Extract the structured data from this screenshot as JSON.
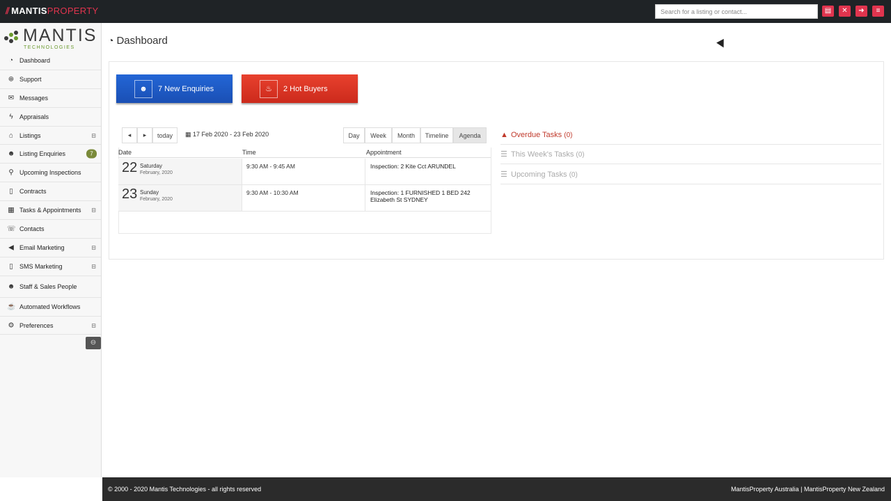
{
  "topbar": {
    "brand_mark": "⫽",
    "brand_part1": "MANTIS",
    "brand_part2": "PROPERTY",
    "search_placeholder": "Search for a listing or contact...",
    "buttons": [
      {
        "icon": "listing-icon",
        "glyph": "▤"
      },
      {
        "icon": "expand-icon",
        "glyph": "✕"
      },
      {
        "icon": "logout-icon",
        "glyph": "➜"
      },
      {
        "icon": "menu-icon",
        "glyph": "≡"
      }
    ]
  },
  "sidebar": {
    "logo_word": "MANTIS",
    "logo_sub": "TECHNOLOGIES",
    "items": [
      {
        "label": "Dashboard",
        "icon": "dashboard-icon",
        "glyph": "◔"
      },
      {
        "label": "Support",
        "icon": "lifebuoy-icon",
        "glyph": "⊕"
      },
      {
        "label": "Messages",
        "icon": "envelope-icon",
        "glyph": "✉"
      },
      {
        "label": "Appraisals",
        "icon": "bolt-icon",
        "glyph": "ϟ"
      },
      {
        "label": "Listings",
        "icon": "home-icon",
        "glyph": "⌂",
        "expand": "⊟"
      },
      {
        "label": "Listing Enquiries",
        "icon": "users-icon",
        "glyph": "☻",
        "badge": "7"
      },
      {
        "label": "Upcoming Inspections",
        "icon": "search-icon",
        "glyph": "⚲"
      },
      {
        "label": "Contracts",
        "icon": "file-icon",
        "glyph": "▯"
      },
      {
        "label": "Tasks & Appointments",
        "icon": "calendar-icon",
        "glyph": "▦",
        "expand": "⊟"
      },
      {
        "label": "Contacts",
        "icon": "phone-icon",
        "glyph": "☏"
      },
      {
        "label": "Email Marketing",
        "icon": "bullhorn-icon",
        "glyph": "◀",
        "expand": "⊟"
      },
      {
        "label": "SMS Marketing",
        "icon": "mobile-icon",
        "glyph": "▯",
        "expand": "⊟"
      },
      {
        "label": "Staff & Sales People",
        "icon": "group-icon",
        "glyph": "☻"
      },
      {
        "label": "Automated Workflows",
        "icon": "coffee-icon",
        "glyph": "☕"
      },
      {
        "label": "Preferences",
        "icon": "gear-icon",
        "glyph": "⚙",
        "expand": "⊟"
      }
    ],
    "collapse_glyph": "⊖"
  },
  "main": {
    "page_title": "Dashboard",
    "title_glyph": "◔",
    "btn_enquiries": {
      "label": "7 New Enquiries",
      "glyph": "☻"
    },
    "btn_hot": {
      "label": "2 Hot Buyers",
      "glyph": "♨"
    },
    "calendar": {
      "prev": "◂",
      "next": "▸",
      "today": "today",
      "range_glyph": "▦",
      "range": "17 Feb 2020 - 23 Feb 2020",
      "views": [
        "Day",
        "Week",
        "Month",
        "Timeline",
        "Agenda"
      ],
      "active_view": "Agenda",
      "headers": {
        "date": "Date",
        "time": "Time",
        "appointment": "Appointment"
      },
      "rows": [
        {
          "day": "22",
          "weekday": "Saturday",
          "month_year": "February, 2020",
          "time": "9:30 AM - 9:45 AM",
          "appointment": "Inspection: 2 Kite Cct ARUNDEL"
        },
        {
          "day": "23",
          "weekday": "Sunday",
          "month_year": "February, 2020",
          "time": "9:30 AM - 10:30 AM",
          "appointment": "Inspection: 1 FURNISHED 1 BED 242 Elizabeth St SYDNEY"
        }
      ]
    },
    "tasks": [
      {
        "label": "Overdue Tasks",
        "count": "(0)",
        "icon": "warning-icon",
        "glyph": "▲"
      },
      {
        "label": "This Week's Tasks",
        "count": "(0)",
        "icon": "list-icon",
        "glyph": "☰"
      },
      {
        "label": "Upcoming Tasks",
        "count": "(0)",
        "icon": "list-icon",
        "glyph": "☰"
      }
    ]
  },
  "footer": {
    "left": "© 2000 - 2020 Mantis Technologies - all rights reserved",
    "right": "MantisProperty Australia | MantisProperty New Zealand"
  }
}
